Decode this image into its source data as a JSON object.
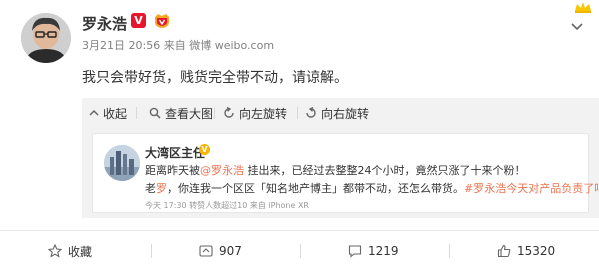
{
  "post": {
    "author": "罗永浩",
    "verified_mark": "V",
    "timestamp": "3月21日 20:56",
    "source_prefix": "来自",
    "source": "微博 weibo.com",
    "text": "我只会带好货，贱货完全带不动，请谅解。"
  },
  "media_toolbar": {
    "collapse": "收起",
    "view_large": "查看大图",
    "rotate_left": "向左旋转",
    "rotate_right": "向右旋转"
  },
  "forwarded": {
    "author": "大湾区主任",
    "verified_mark": "V",
    "line1_a": "距离昨天被",
    "mention": "@罗永浩",
    "line1_b": " 挂出来，已经过去整整24个小时，竟然只涨了十来个粉！",
    "line2_a": "老",
    "line2_link": "罗",
    "line2_b": "，你连我一个区区「知名地产博主」都带不动，还怎么带货。",
    "hashtag": "#罗永浩今天对产品负责了吗#",
    "meta": "今天 17:30 转赞人数超过10  来自 iPhone XR"
  },
  "actions": {
    "favorite": "收藏",
    "repost_count": "907",
    "comment_count": "1219",
    "like_count": "15320"
  },
  "colors": {
    "accent": "#eb7350",
    "verified_red": "#e6162d",
    "toolbar_bg": "#f2f2f2"
  }
}
